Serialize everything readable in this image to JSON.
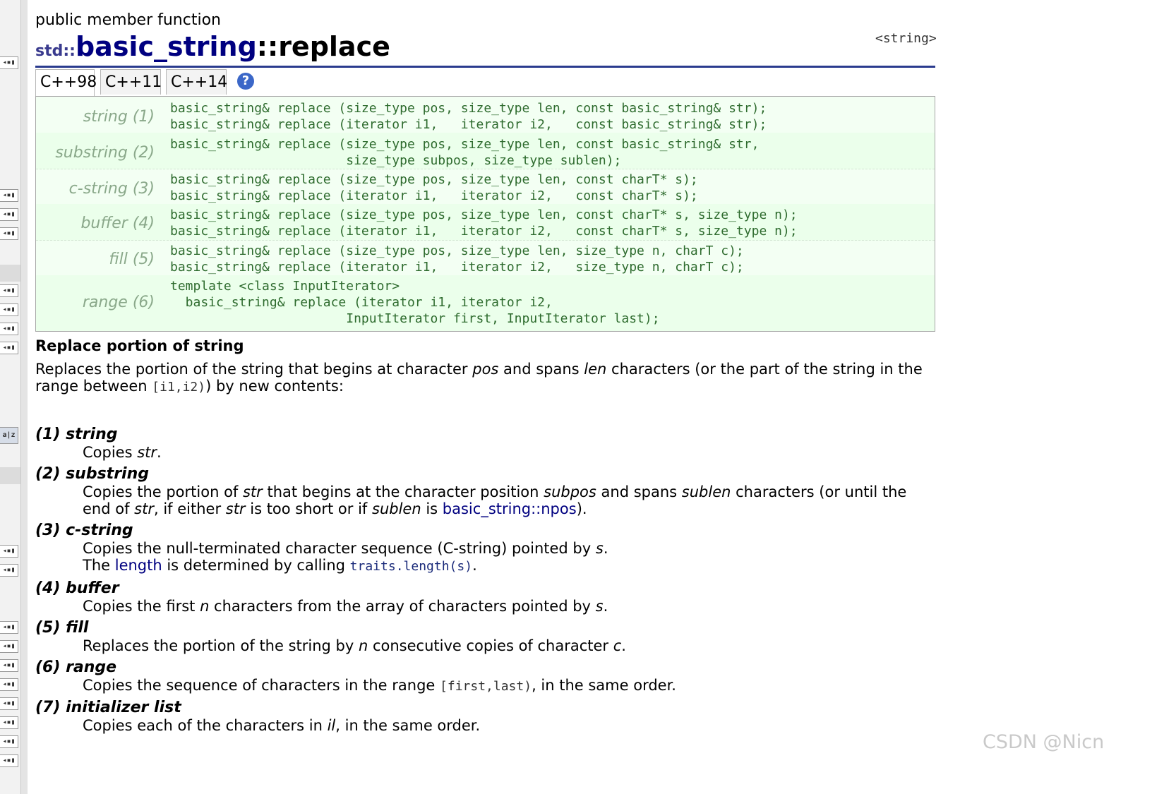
{
  "page": {
    "kind": "public member function",
    "title_ns": "std::",
    "title_class": "basic_string",
    "title_func": "::replace",
    "header": "<string>"
  },
  "tabs": [
    {
      "label": "C++98"
    },
    {
      "label": "C++11"
    },
    {
      "label": "C++14"
    }
  ],
  "help_icon_glyph": "?",
  "sidebar_icon_glyph": "◂▪▮",
  "sidebar_book_glyph": "a|z",
  "prototypes": [
    {
      "label": "string (1)",
      "code": "basic_string& replace (size_type pos, size_type len, const basic_string& str);\nbasic_string& replace (iterator i1,   iterator i2,   const basic_string& str);"
    },
    {
      "label": "substring (2)",
      "code": "basic_string& replace (size_type pos, size_type len, const basic_string& str,\n                       size_type subpos, size_type sublen);"
    },
    {
      "label": "c-string (3)",
      "code": "basic_string& replace (size_type pos, size_type len, const charT* s);\nbasic_string& replace (iterator i1,   iterator i2,   const charT* s);"
    },
    {
      "label": "buffer (4)",
      "code": "basic_string& replace (size_type pos, size_type len, const charT* s, size_type n);\nbasic_string& replace (iterator i1,   iterator i2,   const charT* s, size_type n);"
    },
    {
      "label": "fill (5)",
      "code": "basic_string& replace (size_type pos, size_type len, size_type n, charT c);\nbasic_string& replace (iterator i1,   iterator i2,   size_type n, charT c);"
    },
    {
      "label": "range (6)",
      "code": "template <class InputIterator>\n  basic_string& replace (iterator i1, iterator i2,\n                       InputIterator first, InputIterator last);"
    }
  ],
  "summary": "Replace portion of string",
  "intro": {
    "p1": "Replaces the portion of the string that begins at character ",
    "pos": "pos",
    "p2": " and spans ",
    "len": "len",
    "p3": " characters (or the part of the string in the range between ",
    "range_code": "[i1,i2)",
    "p4": ") by new contents:"
  },
  "items": [
    {
      "title": "(1) string",
      "d1": "Copies ",
      "str": "str",
      "d2": "."
    },
    {
      "title": "(2) substring",
      "d1": "Copies the portion of ",
      "str": "str",
      "d2": " that begins at the character position ",
      "subpos": "subpos",
      "d3": " and spans ",
      "sublen": "sublen",
      "d4": " characters (or until the end of ",
      "str2": "str",
      "d5": ", if either ",
      "str3": "str",
      "d6": " is too short or if ",
      "sublen2": "sublen",
      "d7": " is ",
      "npos": "basic_string::npos",
      "d8": ")."
    },
    {
      "title": "(3) c-string",
      "d1": "Copies the null-terminated character sequence (C-string) pointed by ",
      "s": "s",
      "d2": ".",
      "l2a": "The ",
      "length_link": "length",
      "l2b": " is determined by calling ",
      "traits_code": "traits.length(s)",
      "l2c": "."
    },
    {
      "title": "(4) buffer",
      "d1": "Copies the first ",
      "n": "n",
      "d2": " characters from the array of characters pointed by ",
      "s": "s",
      "d3": "."
    },
    {
      "title": "(5) fill",
      "d1": "Replaces the portion of the string by ",
      "n": "n",
      "d2": " consecutive copies of character ",
      "c": "c",
      "d3": "."
    },
    {
      "title": "(6) range",
      "d1": "Copies the sequence of characters in the range ",
      "range_code": "[first,last)",
      "d2": ", in the same order."
    },
    {
      "title": "(7) initializer list",
      "d1": "Copies each of the characters in ",
      "il": "il",
      "d2": ", in the same order."
    }
  ],
  "watermark": "CSDN @Nicn"
}
